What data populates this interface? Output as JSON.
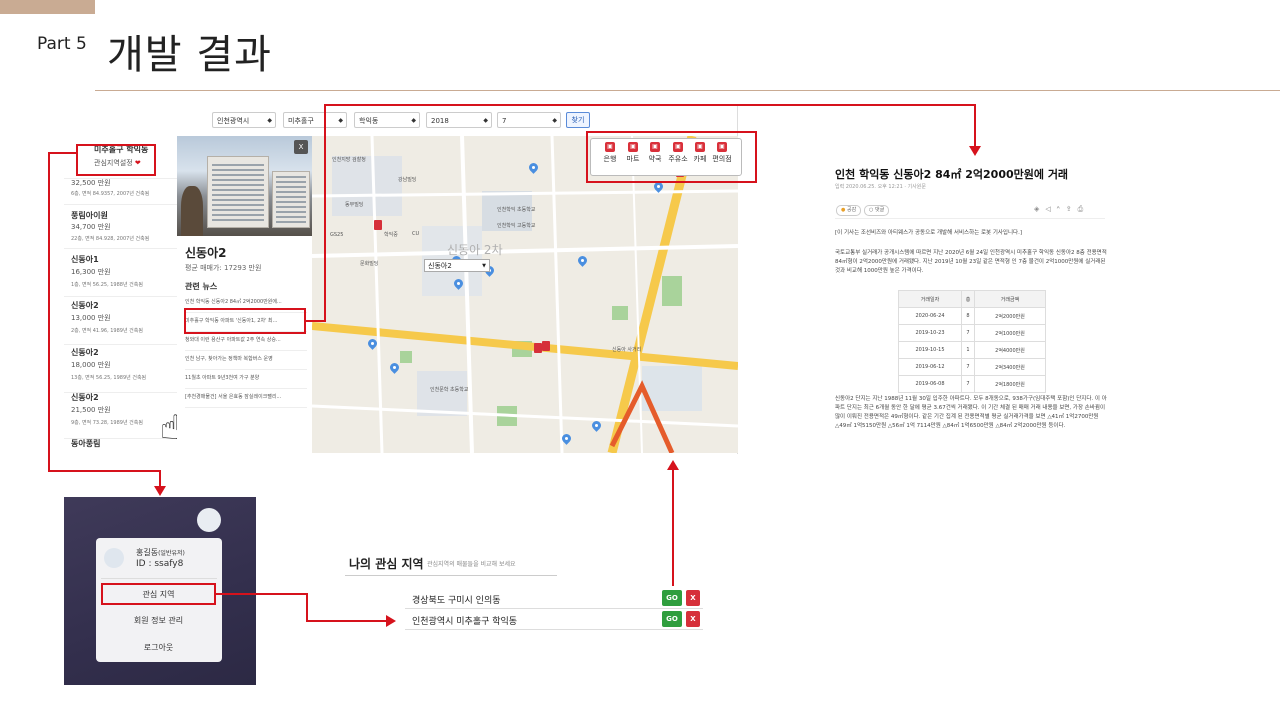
{
  "slide": {
    "part": "Part 5",
    "title": "개발 결과"
  },
  "filters": {
    "city": "인천광역시",
    "district": "미추홀구",
    "dong": "학익동",
    "year": "2018",
    "month": "7",
    "find_label": "찾기"
  },
  "list": {
    "header_name": "미추홀구 학익동",
    "header_fav": "관심지역설정",
    "heart_icon": "heart-icon",
    "items": [
      {
        "name": "",
        "price": "32,500 만원",
        "detail": "6층, 면적 84.9357, 2007년 건축됨"
      },
      {
        "name": "풍림아이원",
        "price": "34,700 만원",
        "detail": "22층, 면적 84.928, 2007년 건축됨"
      },
      {
        "name": "신동아1",
        "price": "16,300 만원",
        "detail": "1층, 면적 56.25, 1988년 건축됨"
      },
      {
        "name": "신동아2",
        "price": "13,000 만원",
        "detail": "2층, 면적 41.96, 1989년 건축됨"
      },
      {
        "name": "신동아2",
        "price": "18,000 만원",
        "detail": "13층, 면적 56.25, 1989년 건축됨"
      },
      {
        "name": "신동아2",
        "price": "21,500 만원",
        "detail": "9층, 면적 73.28, 1989년 건축됨"
      },
      {
        "name": "동아풍림",
        "price": "",
        "detail": ""
      }
    ]
  },
  "detail": {
    "close": "X",
    "name": "신동아2",
    "avg": "평균 매매가: 17293 만원",
    "news_header": "관련 뉴스",
    "news": [
      "인천 학익동 신동아2 84㎡ 2억2000만원에...",
      "미추홀구 학익동 아파트 '신동아1, 2차' 최...",
      "청와대 이런 용산구 아파트값 2주 연속 상승...",
      "인천 남구, 찾아가는 정책마 복합버스 운영",
      "11월초 아파트 9년3천여 가구 분양",
      "[추천경매물건] 서울 은효동 잠실레이크팰리..."
    ]
  },
  "map": {
    "select_value": "신동아2",
    "amenities": [
      "은행",
      "마트",
      "약국",
      "주유소",
      "카페",
      "편의점"
    ],
    "labels": [
      "인천지방 검찰청",
      "동부빌딩",
      "강남빌딩",
      "인천학익 초등학교",
      "신동아 2차",
      "CU",
      "인천문학 초등학교",
      "학익중",
      "GS25",
      "인천학익 고등학교",
      "신동아 사거리",
      "문화빌딩"
    ]
  },
  "article": {
    "title": "인천 학익동 신동아2 84㎡ 2억2000만원에 거래",
    "meta": "입력 2020.06.25. 오후 12:21 · 기사원문",
    "pill1": "공감",
    "pill2": "댓글",
    "intro": "[이 기사는 조선비즈와 아티웨스가 공동으로 개발해 서비스하는 로봇 기사입니다.]",
    "p1": "국토교통부 실거래가 공개시스템에 따르면 지난 2020년 6월 24일 인천광역시 미추홀구 학익동 신동아2 8층 전용면적 84㎡형이 2억2000만원에 거래됐다. 지난 2019년 10월 23일 같은 면적형 인 7층 물건이 2억1000만원에 실거래된 것과 비교해 1000만원 높은 가격이다.",
    "table_head": [
      "거래일자",
      "층",
      "거래금액"
    ],
    "table_rows": [
      [
        "2020-06-24",
        "8",
        "2억2000만원"
      ],
      [
        "2019-10-23",
        "7",
        "2억1000만원"
      ],
      [
        "2019-10-15",
        "1",
        "2억4000만원"
      ],
      [
        "2019-06-12",
        "7",
        "2억3400만원"
      ],
      [
        "2019-06-08",
        "7",
        "2억1800만원"
      ]
    ],
    "p2": "신동아2 단지는 지난 1988년 11월 30일 입주한 아파트다. 모두 8개동으로, 938가구(임대주택 포함)인 단지다. 이 아파트 단지는 최근 6개월 동안 한 달에 평균 3.67건씩 거래됐다. 이 기간 체결 된 매매 거래 내용을 보면, 가장 손바뀜이 많이 이뤄진 전용면적은 49㎡형이다. 같은 기간 집계 된 전용면적별 평균 실거래가격을 보면 △41㎡ 1억2700만원 △49㎡ 1억5150만원 △56㎡ 1억 7114만원 △84㎡ 1억6500만원 △84㎡ 2억2000만원 등이다."
  },
  "login": {
    "user": "홍길동",
    "role": "(일반유저)",
    "id": "ID : ssafy8",
    "menu": [
      "관심 지역",
      "회원 정보 관리",
      "로그아웃"
    ]
  },
  "interest": {
    "title": "나의 관심 지역",
    "sub": "관심지역의 매물들을 비교해 보세요",
    "rows": [
      "경상북도 구미시 인의동",
      "인천광역시 미추홀구 학익동"
    ],
    "go": "GO",
    "del": "X"
  },
  "colors": {
    "accent_red": "#d6121c",
    "slide_accent": "#c9ab93",
    "go_green": "#2f9e3e"
  }
}
